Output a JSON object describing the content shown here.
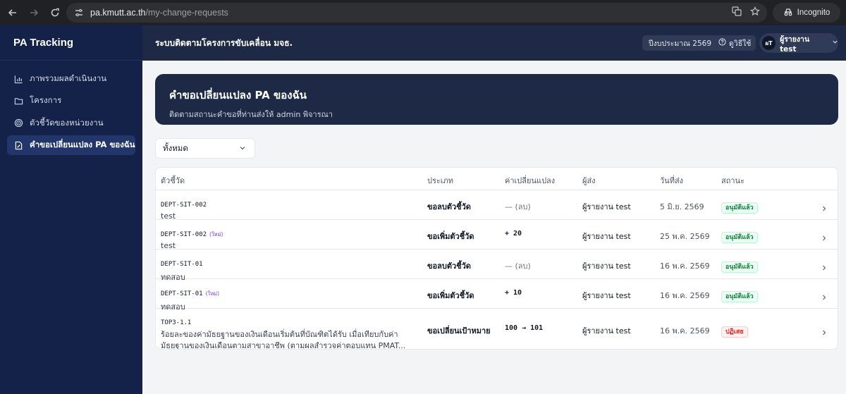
{
  "browser": {
    "url_host": "pa.kmutt.ac.th",
    "url_path": "/my-change-requests",
    "incognito_label": "Incognito"
  },
  "sidebar": {
    "brand": "PA Tracking",
    "items": [
      {
        "label": "ภาพรวมผลดำเนินงาน",
        "icon": "bar-chart-icon",
        "active": false
      },
      {
        "label": "โครงการ",
        "icon": "folder-icon",
        "active": false
      },
      {
        "label": "ตัวชี้วัดของหน่วยงาน",
        "icon": "target-icon",
        "active": false
      },
      {
        "label": "คำขอเปลี่ยนแปลง PA ของฉัน",
        "icon": "file-edit-icon",
        "active": true
      }
    ]
  },
  "header": {
    "title": "ระบบติดตามโครงการขับเคลื่อน มจธ.",
    "fiscal_year": "ปีงบประมาณ 2569",
    "help_label": "ดูวิธีใช้",
    "user_initials": "ผT",
    "user_name": "ผู้รายงาน test"
  },
  "hero": {
    "title": "คำขอเปลี่ยนแปลง PA ของฉัน",
    "subtitle": "ติดตามสถานะคำขอที่ท่านส่งให้ admin พิจารณา"
  },
  "filter": {
    "selected": "ทั้งหมด"
  },
  "table": {
    "headers": {
      "indicator": "ตัวชี้วัด",
      "type": "ประเภท",
      "change": "ค่าเปลี่ยนแปลง",
      "sender": "ผู้ส่ง",
      "date": "วันที่ส่ง",
      "status": "สถานะ"
    },
    "rows": [
      {
        "code": "DEPT-SIT-002",
        "new_tag": "",
        "name": "test",
        "name2": "",
        "type": "ขอลบตัวชี้วัด",
        "change": "— (ลบ)",
        "change_kind": "removed",
        "sender": "ผู้รายงาน test",
        "date": "5 มิ.ย. 2569",
        "status": "อนุมัติแล้ว",
        "status_kind": "ok"
      },
      {
        "code": "DEPT-SIT-002",
        "new_tag": "(ใหม่)",
        "name": "test",
        "name2": "",
        "type": "ขอเพิ่มตัวชี้วัด",
        "change": "+ 20",
        "change_kind": "value",
        "sender": "ผู้รายงาน test",
        "date": "25 พ.ค. 2569",
        "status": "อนุมัติแล้ว",
        "status_kind": "ok"
      },
      {
        "code": "DEPT-SIT-01",
        "new_tag": "",
        "name": "ทดสอบ",
        "name2": "",
        "type": "ขอลบตัวชี้วัด",
        "change": "— (ลบ)",
        "change_kind": "removed",
        "sender": "ผู้รายงาน test",
        "date": "16 พ.ค. 2569",
        "status": "อนุมัติแล้ว",
        "status_kind": "ok"
      },
      {
        "code": "DEPT-SIT-01",
        "new_tag": "(ใหม่)",
        "name": "ทดสอบ",
        "name2": "",
        "type": "ขอเพิ่มตัวชี้วัด",
        "change": "+ 10",
        "change_kind": "value",
        "sender": "ผู้รายงาน test",
        "date": "16 พ.ค. 2569",
        "status": "อนุมัติแล้ว",
        "status_kind": "ok"
      },
      {
        "code": "TOP3-1.1",
        "new_tag": "",
        "name": "ร้อยละของค่ามัธยฐานของเงินเดือนเริ่มต้นที่บัณฑิตได้รับ เมื่อเทียบกับค่า",
        "name2": "มัธยฐานของเงินเดือนตามสาขาอาชีพ (ตามผลสำรวจค่าตอบแทน PMAT...",
        "type": "ขอเปลี่ยนเป้าหมาย",
        "change": "100 → 101",
        "change_kind": "value",
        "sender": "ผู้รายงาน test",
        "date": "16 พ.ค. 2569",
        "status": "ปฏิเสธ",
        "status_kind": "no"
      }
    ]
  }
}
